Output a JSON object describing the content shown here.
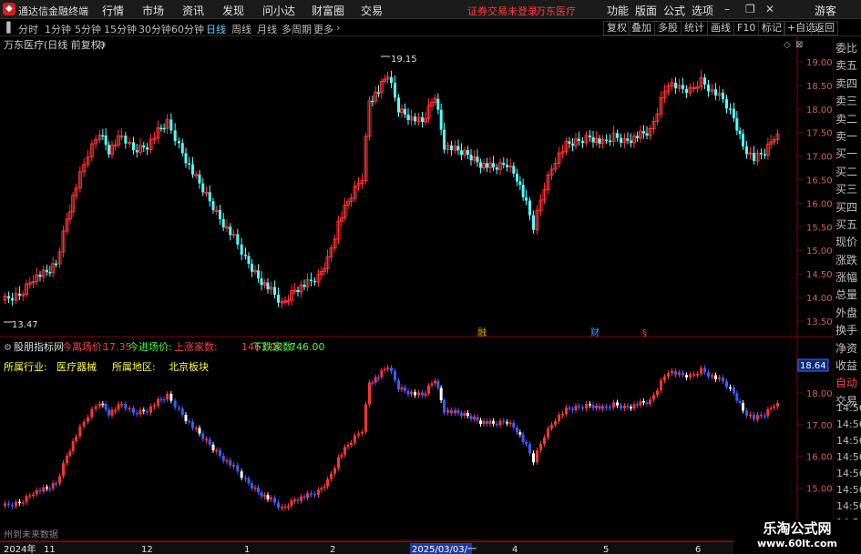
{
  "titlebar": {
    "app_title": "通达信金融终端",
    "menus": [
      "行情",
      "市场",
      "资讯",
      "发现",
      "问小达",
      "财富圈",
      "交易"
    ],
    "notice": "证券交易未登录",
    "stock_name": "万东医疗",
    "right_menus": [
      "功能",
      "版面",
      "公式",
      "选项"
    ],
    "user": "游客"
  },
  "toolbar": {
    "periods": [
      "分时",
      "1分钟",
      "5分钟",
      "15分钟",
      "30分钟",
      "60分钟",
      "日线",
      "周线",
      "月线",
      "多周期",
      "更多"
    ],
    "active_period": "日线",
    "right_buttons": [
      "复权",
      "叠加",
      "多股",
      "统计",
      "画线",
      "F10",
      "标记",
      "+自选",
      "返回"
    ]
  },
  "main_chart": {
    "title": "万东医疗(日线 前复权)",
    "high_label": "19.15",
    "low_label": "13.47",
    "event_labels": [
      "融",
      "财",
      "§"
    ],
    "y_ticks": [
      "19.00",
      "18.50",
      "18.00",
      "17.50",
      "17.00",
      "16.50",
      "16.00",
      "15.50",
      "15.00",
      "14.50",
      "14.00",
      "13.50"
    ]
  },
  "indicator": {
    "name": "股朋指标网",
    "fields": [
      {
        "label": "今离场价:",
        "value": "17.35",
        "color": "#ff4040"
      },
      {
        "label": "今进场价:",
        "value": "",
        "color": "#40ff40"
      },
      {
        "label": "上涨家数:",
        "value": "1463.00",
        "color": "#ff4040"
      },
      {
        "label": "下跌家数:",
        "value": "746.00",
        "color": "#40ff40"
      }
    ],
    "industry_label": "所属行业:",
    "industry_value": "医疗器械",
    "region_label": "所属地区:",
    "region_value": "北京板块",
    "badge": "18.64",
    "y_ticks": [
      "18.00",
      "17.00",
      "16.00",
      "15.00"
    ],
    "footer_text": "州到未来数据"
  },
  "right_panel": {
    "items": [
      "委比",
      "卖五",
      "卖四",
      "卖三",
      "卖二",
      "卖一",
      "买一",
      "买二",
      "买三",
      "买四",
      "买五",
      "现价",
      "涨跌",
      "涨幅",
      "总量",
      "外盘",
      "换手",
      "净资",
      "收益",
      "自动",
      "交易"
    ],
    "times": [
      "14:56",
      "14:56",
      "14:56",
      "14:56",
      "14:56",
      "14:56",
      "14:56",
      "14:56"
    ]
  },
  "date_axis": {
    "labels": [
      "2024年",
      "11",
      "12",
      "1",
      "2",
      "2025/03/03/一",
      "4",
      "5",
      "6"
    ]
  },
  "watermark": {
    "line1": "乐淘公式网",
    "line2": "www.60lt.com"
  },
  "colors": {
    "up": "#ff3232",
    "down": "#54ffff",
    "down2": "#3b5bff",
    "grid": "#7a0000"
  }
}
